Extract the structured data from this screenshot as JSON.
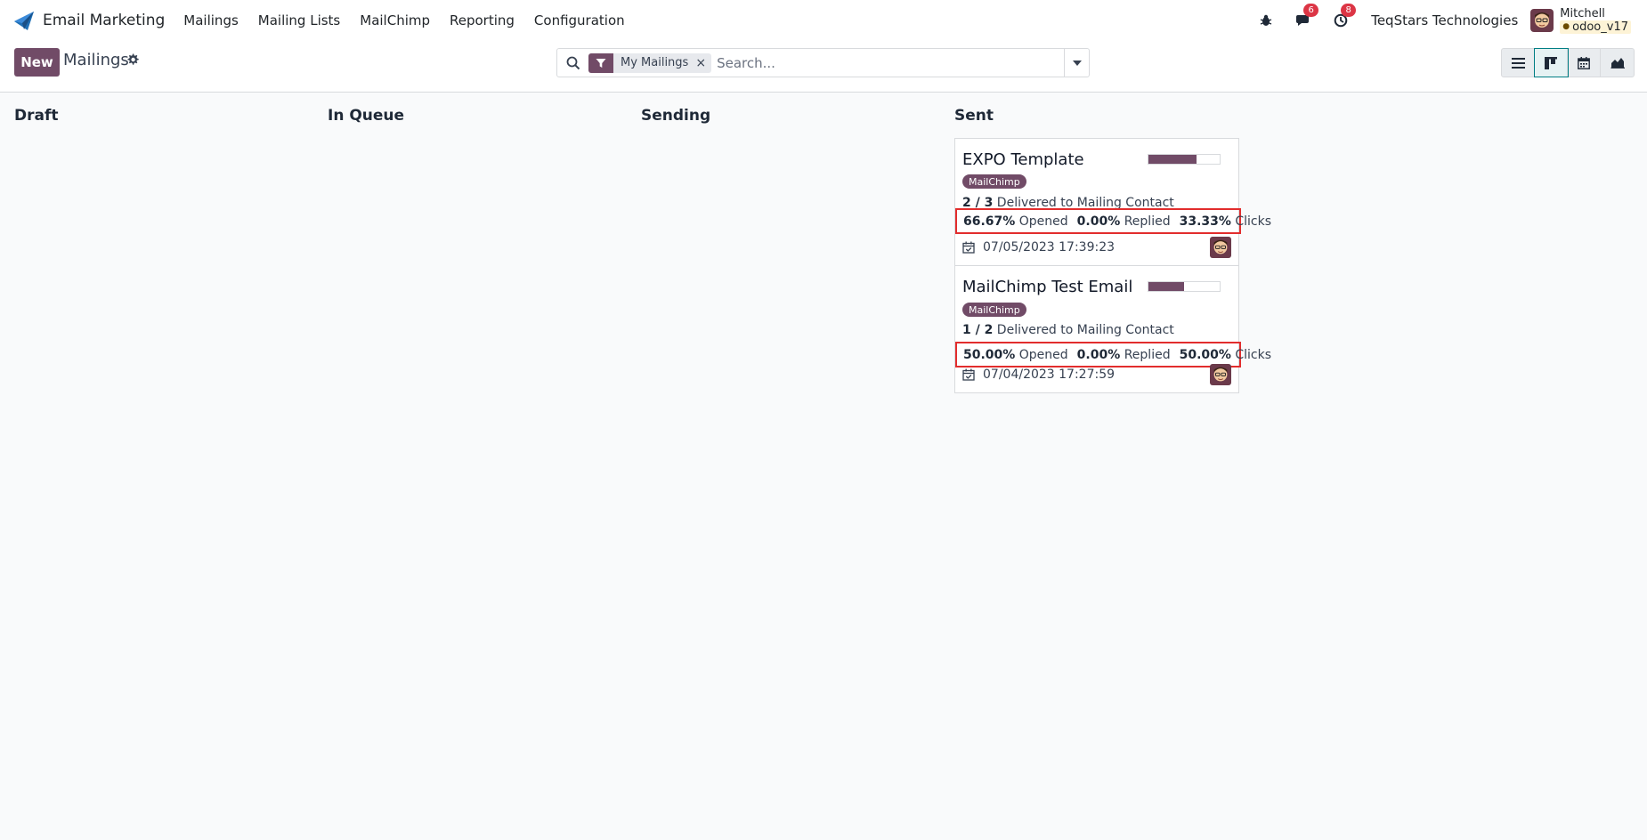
{
  "app": {
    "name": "Email Marketing"
  },
  "menu": [
    "Mailings",
    "Mailing Lists",
    "MailChimp",
    "Reporting",
    "Configuration"
  ],
  "systray": {
    "messages_count": "6",
    "activities_count": "8",
    "company": "TeqStars Technologies",
    "user_name": "Mitchell",
    "database": "odoo_v17"
  },
  "control": {
    "new_label": "New",
    "title": "Mailings",
    "facet": "My Mailings",
    "search_placeholder": "Search..."
  },
  "columns": [
    "Draft",
    "In Queue",
    "Sending",
    "Sent"
  ],
  "cards": [
    {
      "title": "EXPO Template",
      "tag": "MailChimp",
      "progress": 0.67,
      "delivered_count": "2 / 3",
      "delivered_text": "Delivered to Mailing Contact",
      "opened": "66.67%",
      "opened_label": "Opened",
      "replied": "0.00%",
      "replied_label": "Replied",
      "clicks": "33.33%",
      "clicks_label": "Clicks",
      "date": "07/05/2023 17:39:23"
    },
    {
      "title": "MailChimp Test Email",
      "tag": "MailChimp",
      "progress": 0.5,
      "delivered_count": "1 / 2",
      "delivered_text": "Delivered to Mailing Contact",
      "opened": "50.00%",
      "opened_label": "Opened",
      "replied": "0.00%",
      "replied_label": "Replied",
      "clicks": "50.00%",
      "clicks_label": "Clicks",
      "date": "07/04/2023 17:27:59"
    }
  ],
  "colors": {
    "brand": "#714b67",
    "highlight": "#e22d2d",
    "badge": "#dc3545"
  },
  "icons": [
    "bug-icon",
    "chat-icon",
    "clock-icon",
    "gear-icon",
    "search-icon",
    "filter-icon",
    "caret-down-icon",
    "list-view-icon",
    "kanban-view-icon",
    "calendar-view-icon",
    "graph-view-icon",
    "calendar-check-icon"
  ]
}
